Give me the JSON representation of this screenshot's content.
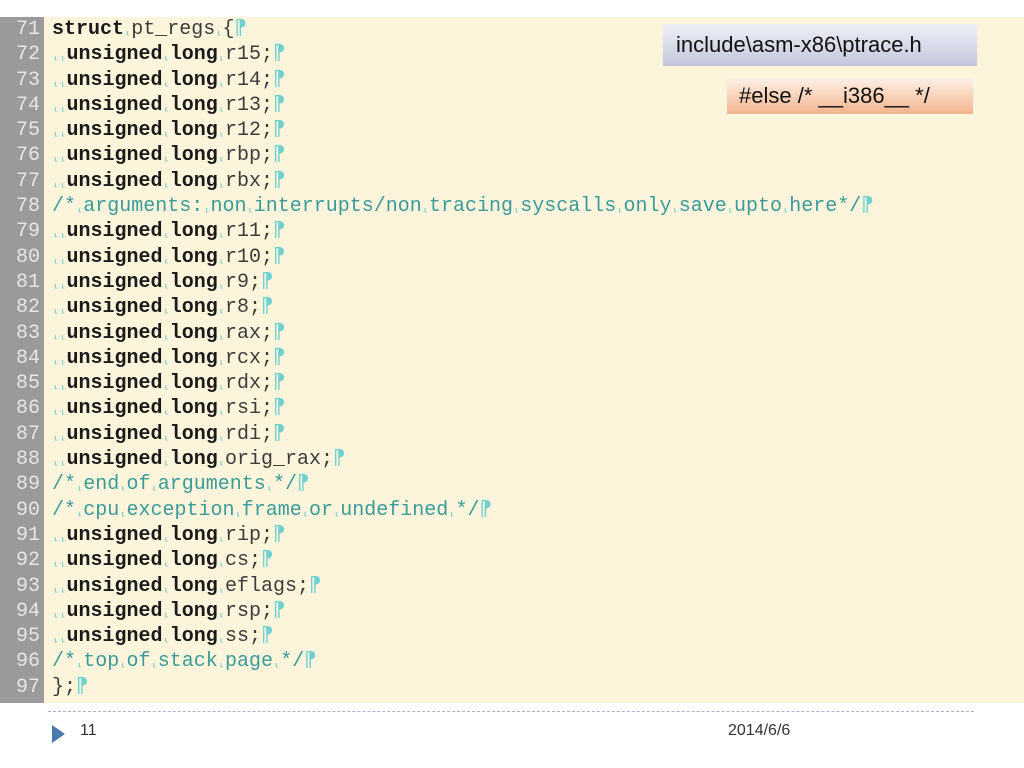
{
  "callouts": {
    "file_path": "include\\asm-x86\\ptrace.h",
    "else_directive": "#else /* __i386__ */"
  },
  "code": {
    "whitespace_glyph": "⸤",
    "eol_glyph": "⁋",
    "lines": [
      {
        "num": "71",
        "tokens": [
          {
            "t": "struct",
            "c": "kw"
          },
          {
            "t": "⸤",
            "c": "ws"
          },
          {
            "t": "pt_regs",
            "c": "tx"
          },
          {
            "t": "⸤",
            "c": "ws"
          },
          {
            "t": "{",
            "c": "tx"
          },
          {
            "t": "⁋",
            "c": "eol"
          }
        ]
      },
      {
        "num": "72",
        "tokens": [
          {
            "t": "⸤⸤",
            "c": "ws"
          },
          {
            "t": "unsigned",
            "c": "kw"
          },
          {
            "t": "⸤",
            "c": "ws"
          },
          {
            "t": "long",
            "c": "kw"
          },
          {
            "t": "⸤",
            "c": "ws"
          },
          {
            "t": "r15;",
            "c": "tx"
          },
          {
            "t": "⁋",
            "c": "eol"
          }
        ]
      },
      {
        "num": "73",
        "tokens": [
          {
            "t": "⸤⸤",
            "c": "ws"
          },
          {
            "t": "unsigned",
            "c": "kw"
          },
          {
            "t": "⸤",
            "c": "ws"
          },
          {
            "t": "long",
            "c": "kw"
          },
          {
            "t": "⸤",
            "c": "ws"
          },
          {
            "t": "r14;",
            "c": "tx"
          },
          {
            "t": "⁋",
            "c": "eol"
          }
        ]
      },
      {
        "num": "74",
        "tokens": [
          {
            "t": "⸤⸤",
            "c": "ws"
          },
          {
            "t": "unsigned",
            "c": "kw"
          },
          {
            "t": "⸤",
            "c": "ws"
          },
          {
            "t": "long",
            "c": "kw"
          },
          {
            "t": "⸤",
            "c": "ws"
          },
          {
            "t": "r13;",
            "c": "tx"
          },
          {
            "t": "⁋",
            "c": "eol"
          }
        ]
      },
      {
        "num": "75",
        "tokens": [
          {
            "t": "⸤⸤",
            "c": "ws"
          },
          {
            "t": "unsigned",
            "c": "kw"
          },
          {
            "t": "⸤",
            "c": "ws"
          },
          {
            "t": "long",
            "c": "kw"
          },
          {
            "t": "⸤",
            "c": "ws"
          },
          {
            "t": "r12;",
            "c": "tx"
          },
          {
            "t": "⁋",
            "c": "eol"
          }
        ]
      },
      {
        "num": "76",
        "tokens": [
          {
            "t": "⸤⸤",
            "c": "ws"
          },
          {
            "t": "unsigned",
            "c": "kw"
          },
          {
            "t": "⸤",
            "c": "ws"
          },
          {
            "t": "long",
            "c": "kw"
          },
          {
            "t": "⸤",
            "c": "ws"
          },
          {
            "t": "rbp;",
            "c": "tx"
          },
          {
            "t": "⁋",
            "c": "eol"
          }
        ]
      },
      {
        "num": "77",
        "tokens": [
          {
            "t": "⸤⸤",
            "c": "ws"
          },
          {
            "t": "unsigned",
            "c": "kw"
          },
          {
            "t": "⸤",
            "c": "ws"
          },
          {
            "t": "long",
            "c": "kw"
          },
          {
            "t": "⸤",
            "c": "ws"
          },
          {
            "t": "rbx;",
            "c": "tx"
          },
          {
            "t": "⁋",
            "c": "eol"
          }
        ]
      },
      {
        "num": "78",
        "tokens": [
          {
            "t": "/*",
            "c": "cm"
          },
          {
            "t": "⸤",
            "c": "ws"
          },
          {
            "t": "arguments:",
            "c": "cm"
          },
          {
            "t": "⸤",
            "c": "ws"
          },
          {
            "t": "non",
            "c": "cm"
          },
          {
            "t": "⸤",
            "c": "ws"
          },
          {
            "t": "interrupts/non",
            "c": "cm"
          },
          {
            "t": "⸤",
            "c": "ws"
          },
          {
            "t": "tracing",
            "c": "cm"
          },
          {
            "t": "⸤",
            "c": "ws"
          },
          {
            "t": "syscalls",
            "c": "cm"
          },
          {
            "t": "⸤",
            "c": "ws"
          },
          {
            "t": "only",
            "c": "cm"
          },
          {
            "t": "⸤",
            "c": "ws"
          },
          {
            "t": "save",
            "c": "cm"
          },
          {
            "t": "⸤",
            "c": "ws"
          },
          {
            "t": "upto",
            "c": "cm"
          },
          {
            "t": "⸤",
            "c": "ws"
          },
          {
            "t": "here*/",
            "c": "cm"
          },
          {
            "t": "⁋",
            "c": "eol"
          }
        ]
      },
      {
        "num": "79",
        "tokens": [
          {
            "t": "⸤⸤",
            "c": "ws"
          },
          {
            "t": "unsigned",
            "c": "kw"
          },
          {
            "t": "⸤",
            "c": "ws"
          },
          {
            "t": "long",
            "c": "kw"
          },
          {
            "t": "⸤",
            "c": "ws"
          },
          {
            "t": "r11;",
            "c": "tx"
          },
          {
            "t": "⁋",
            "c": "eol"
          }
        ]
      },
      {
        "num": "80",
        "tokens": [
          {
            "t": "⸤⸤",
            "c": "ws"
          },
          {
            "t": "unsigned",
            "c": "kw"
          },
          {
            "t": "⸤",
            "c": "ws"
          },
          {
            "t": "long",
            "c": "kw"
          },
          {
            "t": "⸤",
            "c": "ws"
          },
          {
            "t": "r10;",
            "c": "tx"
          },
          {
            "t": "⁋",
            "c": "eol"
          }
        ]
      },
      {
        "num": "81",
        "tokens": [
          {
            "t": "⸤⸤",
            "c": "ws"
          },
          {
            "t": "unsigned",
            "c": "kw"
          },
          {
            "t": "⸤",
            "c": "ws"
          },
          {
            "t": "long",
            "c": "kw"
          },
          {
            "t": "⸤",
            "c": "ws"
          },
          {
            "t": "r9;",
            "c": "tx"
          },
          {
            "t": "⁋",
            "c": "eol"
          }
        ]
      },
      {
        "num": "82",
        "tokens": [
          {
            "t": "⸤⸤",
            "c": "ws"
          },
          {
            "t": "unsigned",
            "c": "kw"
          },
          {
            "t": "⸤",
            "c": "ws"
          },
          {
            "t": "long",
            "c": "kw"
          },
          {
            "t": "⸤",
            "c": "ws"
          },
          {
            "t": "r8;",
            "c": "tx"
          },
          {
            "t": "⁋",
            "c": "eol"
          }
        ]
      },
      {
        "num": "83",
        "tokens": [
          {
            "t": "⸤⸤",
            "c": "ws"
          },
          {
            "t": "unsigned",
            "c": "kw"
          },
          {
            "t": "⸤",
            "c": "ws"
          },
          {
            "t": "long",
            "c": "kw"
          },
          {
            "t": "⸤",
            "c": "ws"
          },
          {
            "t": "rax;",
            "c": "tx"
          },
          {
            "t": "⁋",
            "c": "eol"
          }
        ]
      },
      {
        "num": "84",
        "tokens": [
          {
            "t": "⸤⸤",
            "c": "ws"
          },
          {
            "t": "unsigned",
            "c": "kw"
          },
          {
            "t": "⸤",
            "c": "ws"
          },
          {
            "t": "long",
            "c": "kw"
          },
          {
            "t": "⸤",
            "c": "ws"
          },
          {
            "t": "rcx;",
            "c": "tx"
          },
          {
            "t": "⁋",
            "c": "eol"
          }
        ]
      },
      {
        "num": "85",
        "tokens": [
          {
            "t": "⸤⸤",
            "c": "ws"
          },
          {
            "t": "unsigned",
            "c": "kw"
          },
          {
            "t": "⸤",
            "c": "ws"
          },
          {
            "t": "long",
            "c": "kw"
          },
          {
            "t": "⸤",
            "c": "ws"
          },
          {
            "t": "rdx;",
            "c": "tx"
          },
          {
            "t": "⁋",
            "c": "eol"
          }
        ]
      },
      {
        "num": "86",
        "tokens": [
          {
            "t": "⸤⸤",
            "c": "ws"
          },
          {
            "t": "unsigned",
            "c": "kw"
          },
          {
            "t": "⸤",
            "c": "ws"
          },
          {
            "t": "long",
            "c": "kw"
          },
          {
            "t": "⸤",
            "c": "ws"
          },
          {
            "t": "rsi;",
            "c": "tx"
          },
          {
            "t": "⁋",
            "c": "eol"
          }
        ]
      },
      {
        "num": "87",
        "tokens": [
          {
            "t": "⸤⸤",
            "c": "ws"
          },
          {
            "t": "unsigned",
            "c": "kw"
          },
          {
            "t": "⸤",
            "c": "ws"
          },
          {
            "t": "long",
            "c": "kw"
          },
          {
            "t": "⸤",
            "c": "ws"
          },
          {
            "t": "rdi;",
            "c": "tx"
          },
          {
            "t": "⁋",
            "c": "eol"
          }
        ]
      },
      {
        "num": "88",
        "tokens": [
          {
            "t": "⸤⸤",
            "c": "ws"
          },
          {
            "t": "unsigned",
            "c": "kw"
          },
          {
            "t": "⸤",
            "c": "ws"
          },
          {
            "t": "long",
            "c": "kw"
          },
          {
            "t": "⸤",
            "c": "ws"
          },
          {
            "t": "orig_rax;",
            "c": "tx"
          },
          {
            "t": "⁋",
            "c": "eol"
          }
        ]
      },
      {
        "num": "89",
        "tokens": [
          {
            "t": "/*",
            "c": "cm"
          },
          {
            "t": "⸤",
            "c": "ws"
          },
          {
            "t": "end",
            "c": "cm"
          },
          {
            "t": "⸤",
            "c": "ws"
          },
          {
            "t": "of",
            "c": "cm"
          },
          {
            "t": "⸤",
            "c": "ws"
          },
          {
            "t": "arguments",
            "c": "cm"
          },
          {
            "t": "⸤",
            "c": "ws"
          },
          {
            "t": "*/",
            "c": "cm"
          },
          {
            "t": "⁋",
            "c": "eol"
          }
        ]
      },
      {
        "num": "90",
        "tokens": [
          {
            "t": "/*",
            "c": "cm"
          },
          {
            "t": "⸤",
            "c": "ws"
          },
          {
            "t": "cpu",
            "c": "cm"
          },
          {
            "t": "⸤",
            "c": "ws"
          },
          {
            "t": "exception",
            "c": "cm"
          },
          {
            "t": "⸤",
            "c": "ws"
          },
          {
            "t": "frame",
            "c": "cm"
          },
          {
            "t": "⸤",
            "c": "ws"
          },
          {
            "t": "or",
            "c": "cm"
          },
          {
            "t": "⸤",
            "c": "ws"
          },
          {
            "t": "undefined",
            "c": "cm"
          },
          {
            "t": "⸤",
            "c": "ws"
          },
          {
            "t": "*/",
            "c": "cm"
          },
          {
            "t": "⁋",
            "c": "eol"
          }
        ]
      },
      {
        "num": "91",
        "tokens": [
          {
            "t": "⸤⸤",
            "c": "ws"
          },
          {
            "t": "unsigned",
            "c": "kw"
          },
          {
            "t": "⸤",
            "c": "ws"
          },
          {
            "t": "long",
            "c": "kw"
          },
          {
            "t": "⸤",
            "c": "ws"
          },
          {
            "t": "rip;",
            "c": "tx"
          },
          {
            "t": "⁋",
            "c": "eol"
          }
        ]
      },
      {
        "num": "92",
        "tokens": [
          {
            "t": "⸤⸤",
            "c": "ws"
          },
          {
            "t": "unsigned",
            "c": "kw"
          },
          {
            "t": "⸤",
            "c": "ws"
          },
          {
            "t": "long",
            "c": "kw"
          },
          {
            "t": "⸤",
            "c": "ws"
          },
          {
            "t": "cs;",
            "c": "tx"
          },
          {
            "t": "⁋",
            "c": "eol"
          }
        ]
      },
      {
        "num": "93",
        "tokens": [
          {
            "t": "⸤⸤",
            "c": "ws"
          },
          {
            "t": "unsigned",
            "c": "kw"
          },
          {
            "t": "⸤",
            "c": "ws"
          },
          {
            "t": "long",
            "c": "kw"
          },
          {
            "t": "⸤",
            "c": "ws"
          },
          {
            "t": "eflags;",
            "c": "tx"
          },
          {
            "t": "⁋",
            "c": "eol"
          }
        ]
      },
      {
        "num": "94",
        "tokens": [
          {
            "t": "⸤⸤",
            "c": "ws"
          },
          {
            "t": "unsigned",
            "c": "kw"
          },
          {
            "t": "⸤",
            "c": "ws"
          },
          {
            "t": "long",
            "c": "kw"
          },
          {
            "t": "⸤",
            "c": "ws"
          },
          {
            "t": "rsp;",
            "c": "tx"
          },
          {
            "t": "⁋",
            "c": "eol"
          }
        ]
      },
      {
        "num": "95",
        "tokens": [
          {
            "t": "⸤⸤",
            "c": "ws"
          },
          {
            "t": "unsigned",
            "c": "kw"
          },
          {
            "t": "⸤",
            "c": "ws"
          },
          {
            "t": "long",
            "c": "kw"
          },
          {
            "t": "⸤",
            "c": "ws"
          },
          {
            "t": "ss;",
            "c": "tx"
          },
          {
            "t": "⁋",
            "c": "eol"
          }
        ]
      },
      {
        "num": "96",
        "tokens": [
          {
            "t": "/*",
            "c": "cm"
          },
          {
            "t": "⸤",
            "c": "ws"
          },
          {
            "t": "top",
            "c": "cm"
          },
          {
            "t": "⸤",
            "c": "ws"
          },
          {
            "t": "of",
            "c": "cm"
          },
          {
            "t": "⸤",
            "c": "ws"
          },
          {
            "t": "stack",
            "c": "cm"
          },
          {
            "t": "⸤",
            "c": "ws"
          },
          {
            "t": "page",
            "c": "cm"
          },
          {
            "t": "⸤",
            "c": "ws"
          },
          {
            "t": "*/",
            "c": "cm"
          },
          {
            "t": "⁋",
            "c": "eol"
          }
        ]
      },
      {
        "num": "97",
        "tokens": [
          {
            "t": "};",
            "c": "tx"
          },
          {
            "t": "⁋",
            "c": "eol"
          }
        ]
      }
    ]
  },
  "footer": {
    "page_number": "11",
    "date": "2014/6/6"
  },
  "colors": {
    "editor_background": "#fdf5db",
    "gutter_background": "#9a9a9a",
    "comment": "#3b9a9a",
    "keyword": "#1a1a1a",
    "accent_arrow": "#4a79b0"
  }
}
